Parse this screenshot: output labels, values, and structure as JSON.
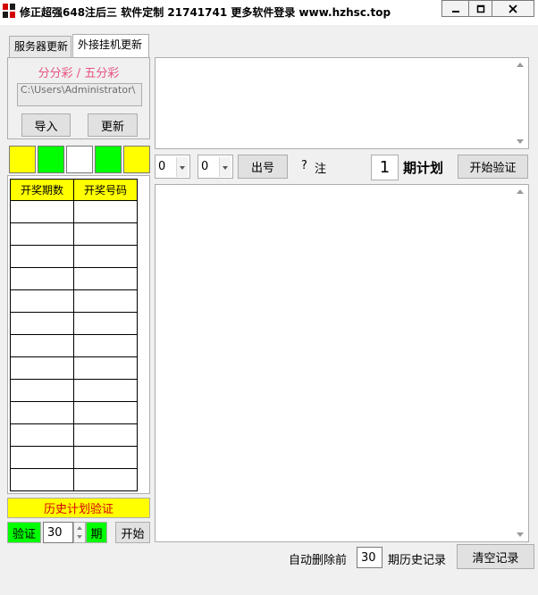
{
  "window": {
    "title": "修正超强648注后三 软件定制 21741741 更多软件登录 www.hzhsc.top",
    "icon": "app-logo-icon"
  },
  "tabs": [
    {
      "label": "服务器更新",
      "active": false
    },
    {
      "label": "外接挂机更新",
      "active": true
    }
  ],
  "panel": {
    "lottery_label": "分分彩 / 五分彩",
    "path_value": "C:\\Users\\Administrator\\",
    "import_label": "导入",
    "update_label": "更新"
  },
  "color_boxes": [
    "#ffff00",
    "#00ff00",
    "#ffffff",
    "#00ff00",
    "#ffff00"
  ],
  "history_table": {
    "headers": [
      "开奖期数",
      "开奖号码"
    ],
    "rows": 13
  },
  "verify": {
    "history_label": "历史计划验证",
    "verify_label": "验证",
    "count": "30",
    "period_label": "期",
    "start_label": "开始"
  },
  "controls": {
    "select1_value": "0",
    "select2_value": "0",
    "output_label": "出号",
    "bet_count": "?",
    "bet_unit": "注",
    "plan_number": "1",
    "plan_label": "期计划",
    "start_verify_label": "开始验证"
  },
  "footer": {
    "auto_delete_label": "自动删除前",
    "delete_count": "30",
    "history_records_label": "期历史记录",
    "clear_label": "清空记录"
  },
  "colors": {
    "yellow": "#ffff00",
    "green": "#00ff00",
    "pink": "#e75480",
    "red": "#d40000"
  }
}
